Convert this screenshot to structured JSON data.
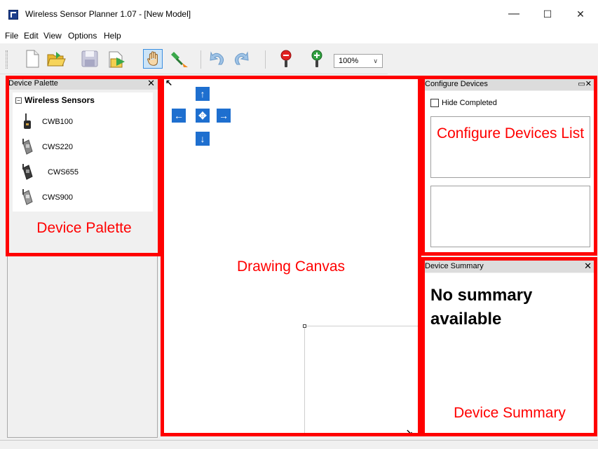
{
  "window": {
    "title": "Wireless Sensor Planner 1.07 - [New Model]",
    "minimize_glyph": "—",
    "maximize_glyph": "☐",
    "close_glyph": "✕"
  },
  "menu": {
    "items": [
      {
        "label": "File"
      },
      {
        "label": "Edit"
      },
      {
        "label": "View"
      },
      {
        "label": "Options"
      },
      {
        "label": "Help"
      }
    ]
  },
  "toolbar": {
    "buttons": [
      {
        "icon": "new-document-icon"
      },
      {
        "icon": "open-folder-icon"
      },
      {
        "icon": "save-disk-icon"
      },
      {
        "icon": "import-export-icon"
      },
      {
        "icon": "hand-pan-icon"
      },
      {
        "icon": "connect-plug-icon"
      },
      {
        "icon": "undo-icon"
      },
      {
        "icon": "redo-icon"
      },
      {
        "icon": "zoom-out-icon"
      },
      {
        "icon": "zoom-in-icon"
      }
    ],
    "zoom_value": "100%"
  },
  "device_palette": {
    "title": "Device Palette",
    "close_glyph": "✕",
    "tree_toggle": "−",
    "root_label": "Wireless Sensors",
    "devices": [
      {
        "label": "CWB100"
      },
      {
        "label": "CWS220"
      },
      {
        "label": "CWS655"
      },
      {
        "label": "CWS900"
      }
    ]
  },
  "canvas": {
    "nav": {
      "up": "↑",
      "left": "←",
      "center": "✥",
      "right": "→",
      "down": "↓"
    }
  },
  "configure_devices": {
    "title": "Configure Devices",
    "controls_glyph": "▭✕",
    "hide_completed_label": "Hide Completed",
    "hide_completed_checked": false
  },
  "device_summary": {
    "title": "Device Summary",
    "close_glyph": "✕",
    "message": "No summary available"
  },
  "annotations": {
    "device_palette": "Device Palette",
    "drawing_canvas": "Drawing Canvas",
    "configure_devices_list": "Configure Devices List",
    "device_summary": "Device Summary",
    "color": "#ff0000"
  }
}
